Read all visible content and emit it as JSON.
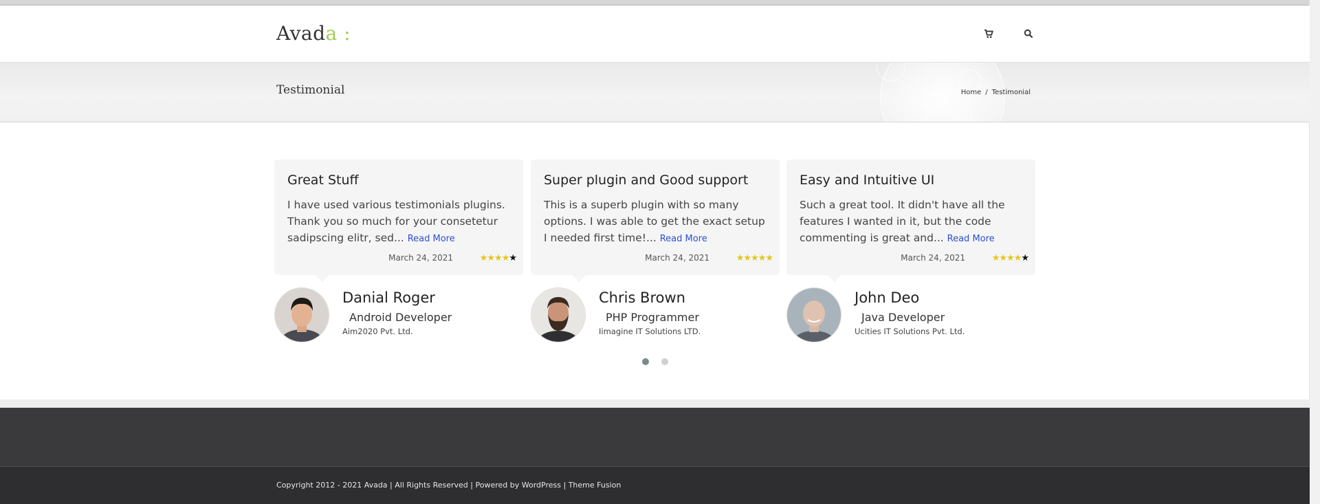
{
  "header": {
    "logo_text": "Avad",
    "logo_accent": "a :",
    "cart_icon": "cart-icon",
    "search_icon": "search-icon",
    "accent_color": "#a0ce4e"
  },
  "titlebar": {
    "title": "Testimonial",
    "breadcrumb": {
      "home": "Home",
      "separator": "/",
      "current": "Testimonial"
    }
  },
  "testimonials": [
    {
      "title": "Great Stuff",
      "text": "I have used various testimonials plugins. Thank you so much for your consetetur sadipscing elitr, sed...",
      "read_more": "Read More",
      "date": "March 24, 2021",
      "rating": 4,
      "name": "Danial Roger",
      "role": "Android Developer",
      "company": "Aim2020 Pvt. Ltd."
    },
    {
      "title": "Super plugin and Good support",
      "text": "This is a superb plugin with so many options. I was able to get the exact setup I needed first time!...",
      "read_more": "Read More",
      "date": "March 24, 2021",
      "rating": 5,
      "name": "Chris Brown",
      "role": "PHP Programmer",
      "company": "Iimagine IT Solutions LTD."
    },
    {
      "title": "Easy and Intuitive UI",
      "text": "Such a great tool. It didn't have all the features I wanted in it, but the code commenting is great and...",
      "read_more": "Read More",
      "date": "March 24, 2021",
      "rating": 4,
      "name": "John Deo",
      "role": "Java Developer",
      "company": "Ucities IT Solutions Pvt. Ltd."
    }
  ],
  "pagination": {
    "count": 2,
    "active": 1,
    "active_color": "#7a8a8f",
    "inactive_color": "#d0d0d0"
  },
  "footer": {
    "copyright": "Copyright 2012 - 2021 Avada | All Rights Reserved | Powered by",
    "wordpress": "WordPress",
    "separator": "|",
    "theme": "Theme Fusion"
  }
}
